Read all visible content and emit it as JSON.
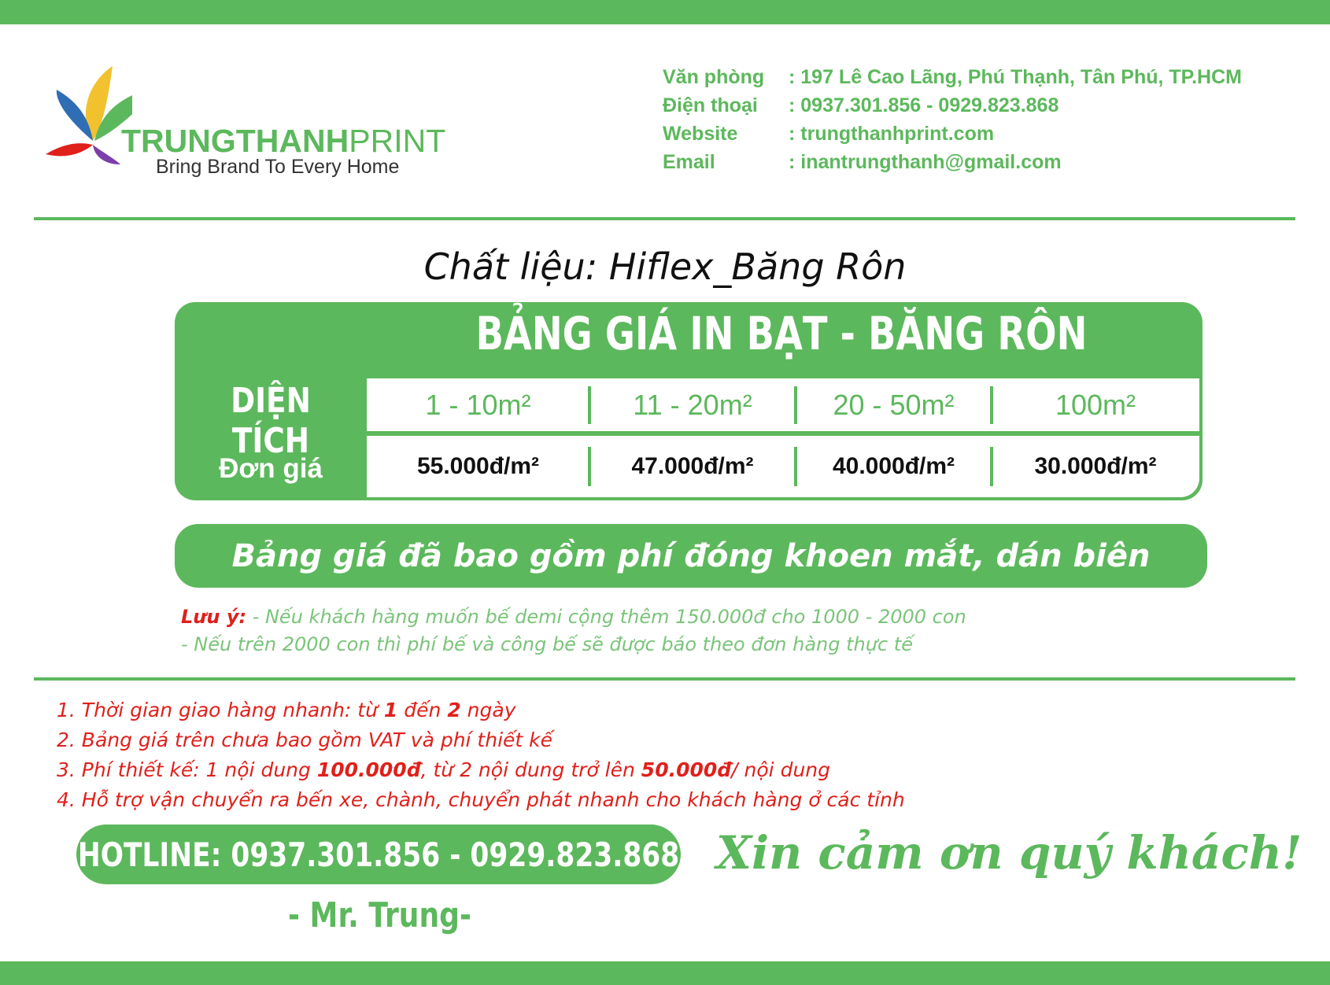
{
  "brand": {
    "name_bold": "TRUNGTHANH",
    "name_light": "PRINT",
    "tagline": "Bring Brand To Every Home"
  },
  "contact": [
    {
      "label": "Văn phòng",
      "value": ": 197 Lê Cao Lãng, Phú Thạnh, Tân Phú, TP.HCM"
    },
    {
      "label": "Điện thoại",
      "value": ": 0937.301.856 - 0929.823.868"
    },
    {
      "label": "Website",
      "value": ": trungthanhprint.com"
    },
    {
      "label": "Email",
      "value": ": inantrungthanh@gmail.com"
    }
  ],
  "material": "Chất liệu: Hiflex_Băng Rôn",
  "price_table": {
    "title": "BẢNG GIÁ IN BẠT - BĂNG RÔN",
    "area_label": "DIỆN TÍCH",
    "price_label": "Đơn giá",
    "areas": [
      "1 - 10m²",
      "11 - 20m²",
      "20 - 50m²",
      "100m²"
    ],
    "prices": [
      "55.000đ/m²",
      "47.000đ/m²",
      "40.000đ/m²",
      "30.000đ/m²"
    ]
  },
  "included_banner": "Bảng giá đã bao gồm phí đóng khoen mắt, dán biên",
  "notes": {
    "label": "Lưu ý:",
    "line1": " - Nếu  khách hàng muốn bế demi cộng thêm 150.000đ cho 1000 - 2000 con",
    "line2": "- Nếu trên 2000 con thì phí bế và công bế sẽ được báo theo đơn hàng thực tế"
  },
  "terms": {
    "t1_a": "1. Thời gian giao hàng nhanh: từ ",
    "t1_b": "1",
    "t1_c": " đến ",
    "t1_d": "2",
    "t1_e": " ngày",
    "t2": "2. Bảng giá trên chưa bao gồm VAT và phí thiết kế",
    "t3_a": "3. Phí thiết kế: 1 nội dung ",
    "t3_b": "100.000đ",
    "t3_c": ", từ 2 nội dung trở lên ",
    "t3_d": "50.000đ",
    "t3_e": "/ nội dung",
    "t4": "4. Hỗ trợ vận chuyển ra bến xe, chành, chuyển phát nhanh cho khách hàng ở các tỉnh"
  },
  "hotline": "HOTLINE: 0937.301.856 - 0929.823.868",
  "thanks": "Xin cảm ơn quý khách!",
  "signature": "- Mr. Trung-",
  "colors": {
    "green": "#5cb85c",
    "red": "#e0201b"
  }
}
